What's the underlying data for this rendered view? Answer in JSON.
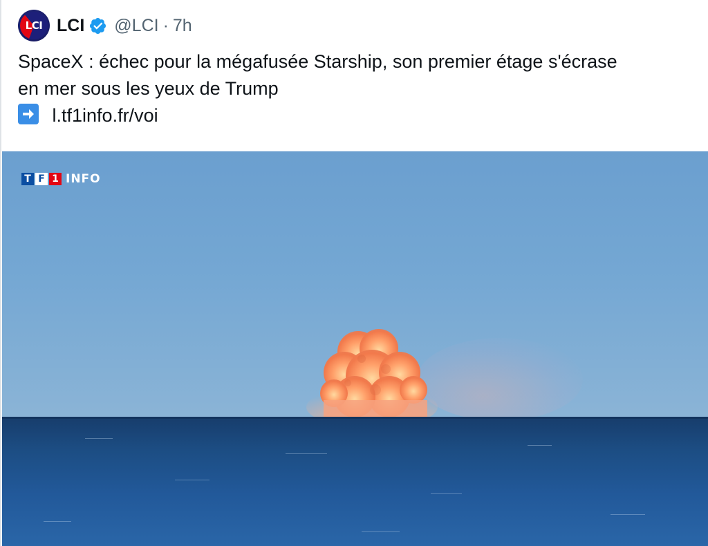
{
  "author": {
    "avatar_text": "LCI",
    "display_name": "LCI",
    "handle": "@LCI",
    "separator": "·",
    "time": "7h",
    "verified_icon": "verified-badge-icon",
    "verified_color": "#1d9bf0"
  },
  "tweet": {
    "text_line1": "SpaceX : échec pour la mégafusée Starship, son premier étage s'écrase",
    "text_line2": "en mer sous les yeux de Trump",
    "link_icon": "right-arrow-emoji-icon",
    "link_text": "l.tf1info.fr/voi"
  },
  "media": {
    "description_icon": "photo",
    "logo_letters": [
      "T",
      "F",
      "1"
    ],
    "logo_suffix": "INFO",
    "logo_colors": [
      "#0b4ea2",
      "#ffffff",
      "#e30613"
    ]
  }
}
